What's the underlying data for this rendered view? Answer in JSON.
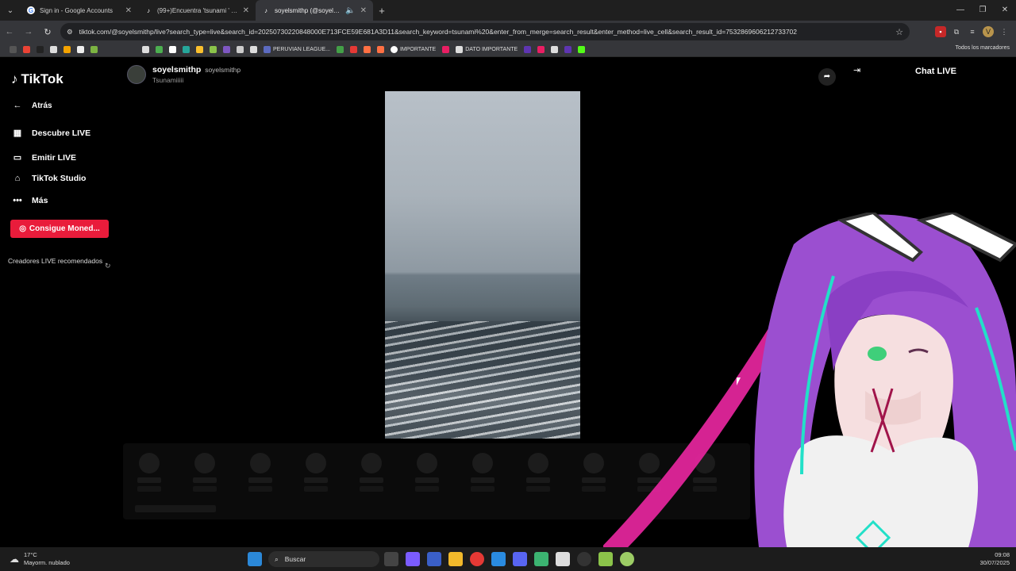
{
  "browser": {
    "tabs": [
      {
        "title": "Sign in - Google Accounts",
        "active": false
      },
      {
        "title": "(99+)Encuentra 'tsunami ' en TikTok",
        "active": false
      },
      {
        "title": "soyelsmithp (@soyelsmithp)",
        "active": true
      }
    ],
    "url": "tiktok.com/@soyelsmithp/live?search_type=live&search_id=20250730220848000E713FCE59E681A3D11&search_keyword=tsunami%20&enter_from_merge=search_result&enter_method=live_cell&search_result_id=7532869606212733702",
    "bookmarks": [
      "PERUVIAN LEAGUE...",
      "IMPORTANTE",
      "DATO IMPORTANTE"
    ],
    "bookmarks_all": "Todos los marcadores"
  },
  "tiktok": {
    "logo": "TikTok",
    "sidebar": {
      "back": "Atrás",
      "items": [
        {
          "label": "Descubre LIVE",
          "icon": "calendar-icon"
        },
        {
          "label": "Emitir LIVE",
          "icon": "camera-icon"
        },
        {
          "label": "TikTok Studio",
          "icon": "house-icon"
        },
        {
          "label": "Más",
          "icon": "dots-icon"
        }
      ],
      "coins_button": "Consigue Moned...",
      "recommended": "Creadores LIVE recomendados"
    },
    "stream": {
      "host_name": "soyelsmithp",
      "host_handle": "soyelsmithp",
      "title": "Tsunamiiiii"
    },
    "chat": {
      "title": "Chat LIVE"
    }
  },
  "taskbar": {
    "temperature": "17°C",
    "weather": "Mayorm. nublado",
    "search": "Buscar",
    "time": "09:08",
    "date": "30/07/2025"
  },
  "colors": {
    "accent": "#e91c3b",
    "chrome_bg": "#35363a"
  }
}
